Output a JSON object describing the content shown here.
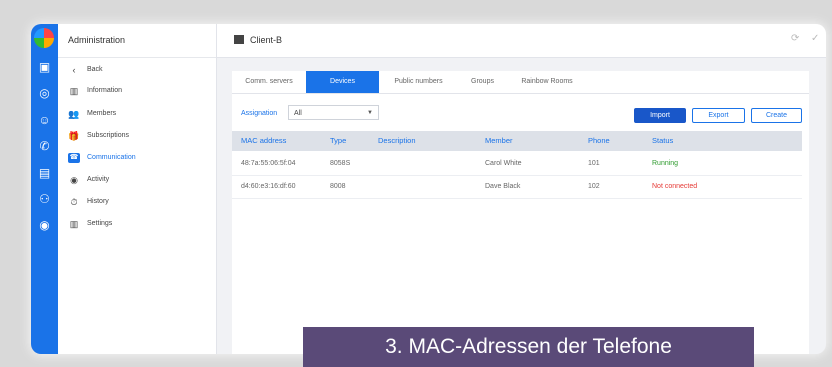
{
  "sidebar": {
    "header": "Administration",
    "items": [
      {
        "label": "Back",
        "icon": "chevron-left-icon",
        "glyph": "‹",
        "active": false
      },
      {
        "label": "Information",
        "icon": "building-icon",
        "glyph": "▥",
        "active": false
      },
      {
        "label": "Members",
        "icon": "people-icon",
        "glyph": "👥",
        "active": false
      },
      {
        "label": "Subscriptions",
        "icon": "gift-icon",
        "glyph": "🎁",
        "active": false
      },
      {
        "label": "Communication",
        "icon": "phone-icon",
        "glyph": "☎",
        "active": true
      },
      {
        "label": "Activity",
        "icon": "activity-icon",
        "glyph": "◉",
        "active": false
      },
      {
        "label": "History",
        "icon": "clock-icon",
        "glyph": "⏱",
        "active": false
      },
      {
        "label": "Settings",
        "icon": "building-icon",
        "glyph": "▥",
        "active": false
      }
    ]
  },
  "header": {
    "title": "Client-B"
  },
  "tabs": [
    {
      "label": "Comm. servers",
      "active": false
    },
    {
      "label": "Devices",
      "active": true
    },
    {
      "label": "Public numbers",
      "active": false
    },
    {
      "label": "Groups",
      "active": false
    },
    {
      "label": "Rainbow Rooms",
      "active": false
    }
  ],
  "filter": {
    "label": "Assignation",
    "value": "All"
  },
  "buttons": {
    "import": "Import",
    "export": "Export",
    "create": "Create"
  },
  "table": {
    "columns": [
      "MAC address",
      "Type",
      "Description",
      "Member",
      "Phone",
      "Status"
    ],
    "rows": [
      {
        "mac": "48:7a:55:06:5f:04",
        "type": "8058S",
        "description": "",
        "member": "Carol White",
        "phone": "101",
        "status": "Running",
        "status_kind": "ok"
      },
      {
        "mac": "d4:60:e3:16:df:60",
        "type": "8008",
        "description": "",
        "member": "Dave Black",
        "phone": "102",
        "status": "Not connected",
        "status_kind": "bad"
      }
    ]
  },
  "caption": "3. MAC-Adressen der Telefone",
  "colors": {
    "accent": "#1a73e8",
    "primary_button": "#1957c9",
    "running": "#2e9b2e",
    "not_connected": "#e53935",
    "caption_bg": "#5a4a78"
  }
}
